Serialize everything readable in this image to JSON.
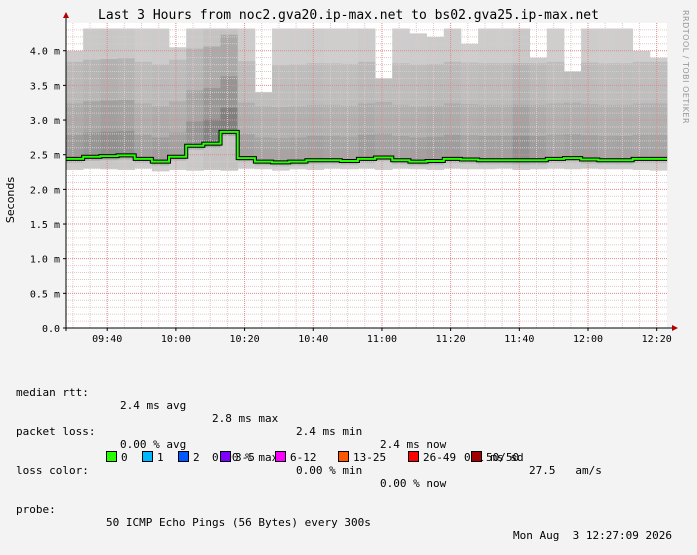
{
  "title": "Last 3 Hours from noc2.gva20.ip-max.net to bs02.gva25.ip-max.net",
  "watermark": "RRDTOOL / TOBI OETIKER",
  "stats": {
    "median_rtt_label": "median rtt:",
    "median_avg": "2.4 ms avg",
    "median_max": "2.8 ms max",
    "median_min": "2.4 ms min",
    "median_now": "2.4 ms now",
    "median_sd": "0.1 ms sd",
    "median_ams": "27.5   am/s",
    "packet_loss_label": "packet loss:",
    "loss_avg": "0.00 % avg",
    "loss_max": "0.00 % max",
    "loss_min": "0.00 % min",
    "loss_now": "0.00 % now",
    "loss_color_label": "loss color:",
    "probe_label": "probe:",
    "probe_text": "50 ICMP Echo Pings (56 Bytes) every 300s",
    "timestamp": "Mon Aug  3 12:27:09 2026"
  },
  "loss_colors": [
    {
      "label": "0",
      "color": "#26ff00"
    },
    {
      "label": "1",
      "color": "#00b8ff"
    },
    {
      "label": "2",
      "color": "#0059ff"
    },
    {
      "label": "3-5",
      "color": "#7e00ff"
    },
    {
      "label": "6-12",
      "color": "#ff00ff"
    },
    {
      "label": "13-25",
      "color": "#ff5500"
    },
    {
      "label": "26-49",
      "color": "#ff0000"
    },
    {
      "label": "50/50",
      "color": "#a10000"
    }
  ],
  "chart_data": {
    "type": "line",
    "title": "Last 3 Hours from noc2.gva20.ip-max.net to bs02.gva25.ip-max.net",
    "ylabel": "Seconds",
    "xlabel": "",
    "ylim": [
      0,
      4.4
    ],
    "y_ticks": [
      0,
      0.5,
      1.0,
      1.5,
      2.0,
      2.5,
      3.0,
      3.5,
      4.0
    ],
    "y_tick_labels": [
      "0.0",
      "0.5 m",
      "1.0 m",
      "1.5 m",
      "2.0 m",
      "2.5 m",
      "3.0 m",
      "3.5 m",
      "4.0 m"
    ],
    "y_unit": "ms",
    "x_tick_labels": [
      "09:40",
      "10:00",
      "10:20",
      "10:40",
      "11:00",
      "11:20",
      "11:40",
      "12:00",
      "12:20"
    ],
    "x_tick_minutes": [
      40,
      60,
      80,
      100,
      120,
      140,
      160,
      180,
      200
    ],
    "x_start_minutes": 28,
    "interval_minutes": 5,
    "grid": true,
    "series": [
      {
        "name": "median rtt",
        "color": "#26ff00",
        "values": [
          2.44,
          2.47,
          2.48,
          2.49,
          2.44,
          2.4,
          2.47,
          2.63,
          2.66,
          2.83,
          2.45,
          2.4,
          2.39,
          2.4,
          2.42,
          2.42,
          2.41,
          2.44,
          2.46,
          2.42,
          2.4,
          2.41,
          2.44,
          2.43,
          2.42,
          2.42,
          2.42,
          2.42,
          2.44,
          2.45,
          2.43,
          2.42,
          2.42,
          2.44,
          2.44
        ]
      }
    ],
    "smoke": {
      "low": [
        2.28,
        2.3,
        2.29,
        2.28,
        2.3,
        2.26,
        2.28,
        2.27,
        2.28,
        2.27,
        2.3,
        2.29,
        2.27,
        2.29,
        2.28,
        2.3,
        2.29,
        2.3,
        2.28,
        2.3,
        2.29,
        2.28,
        2.3,
        2.29,
        2.29,
        2.3,
        2.28,
        2.29,
        2.3,
        2.29,
        2.3,
        2.29,
        2.29,
        2.28,
        2.27
      ],
      "high": [
        4.0,
        4.32,
        4.32,
        4.32,
        4.32,
        4.32,
        4.05,
        4.32,
        4.32,
        4.32,
        4.32,
        3.4,
        4.32,
        4.32,
        4.32,
        4.32,
        4.32,
        4.32,
        3.6,
        4.32,
        4.25,
        4.2,
        4.32,
        4.1,
        4.32,
        4.32,
        4.32,
        3.9,
        4.32,
        3.7,
        4.32,
        4.32,
        4.32,
        4.0,
        3.9
      ],
      "darkness": [
        0.45,
        0.55,
        0.65,
        0.6,
        0.4,
        0.45,
        0.4,
        0.55,
        0.8,
        0.85,
        0.4,
        0.35,
        0.35,
        0.38,
        0.4,
        0.35,
        0.35,
        0.45,
        0.38,
        0.38,
        0.4,
        0.45,
        0.45,
        0.35,
        0.4,
        0.4,
        0.6,
        0.45,
        0.35,
        0.4,
        0.4,
        0.35,
        0.38,
        0.35,
        0.35
      ]
    }
  }
}
